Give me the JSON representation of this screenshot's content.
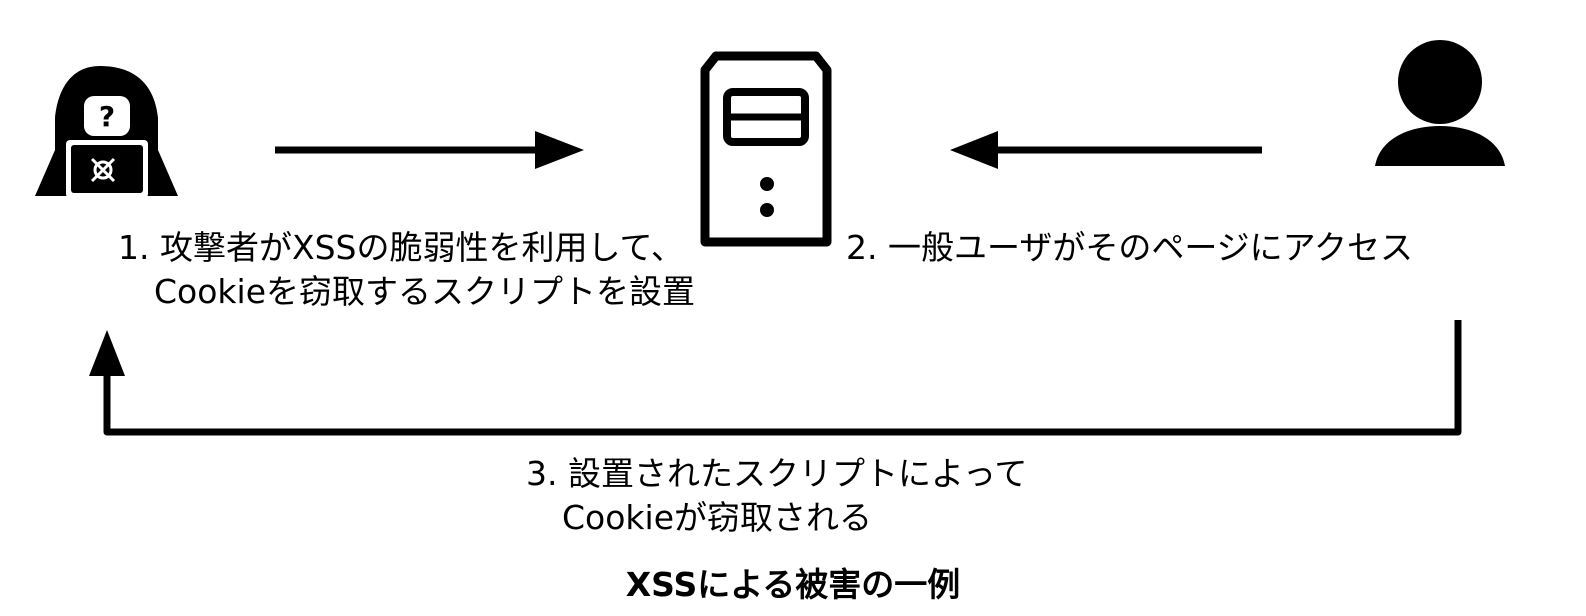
{
  "actors": {
    "attacker": {
      "icon": "hacker-icon"
    },
    "server": {
      "icon": "server-icon"
    },
    "user": {
      "icon": "user-icon"
    }
  },
  "steps": {
    "step1": {
      "line1": "1. 攻撃者がXSSの脆弱性を利用して、",
      "line2": "Cookieを窃取するスクリプトを設置"
    },
    "step2": {
      "line1": "2. 一般ユーザがそのページにアクセス"
    },
    "step3": {
      "line1": "3. 設置されたスクリプトによって",
      "line2": "Cookieが窃取される"
    }
  },
  "caption": "XSSによる被害の一例",
  "colors": {
    "stroke": "#000000",
    "background": "#ffffff"
  }
}
